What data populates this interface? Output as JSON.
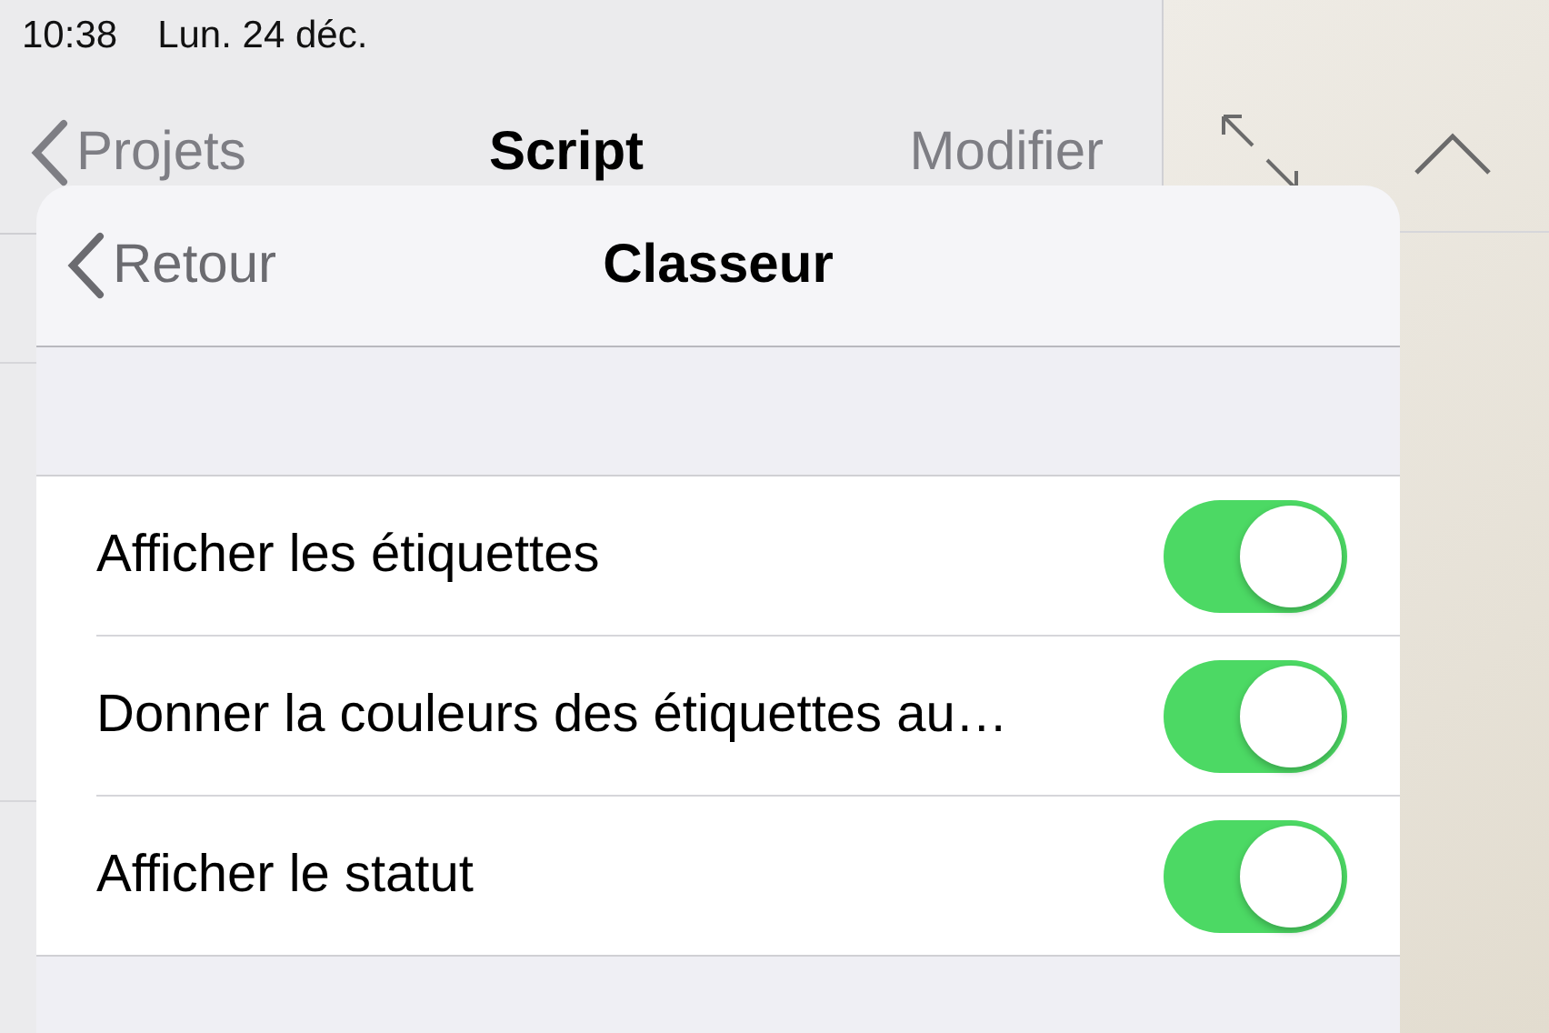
{
  "status_bar": {
    "time": "10:38",
    "date": "Lun. 24 déc."
  },
  "nav_bar": {
    "back": "Projets",
    "title": "Script",
    "action": "Modifier"
  },
  "popover": {
    "back": "Retour",
    "title": "Classeur",
    "settings": [
      {
        "label": "Afficher les étiquettes",
        "on": true
      },
      {
        "label": "Donner la couleurs des étiquettes au…",
        "on": true
      },
      {
        "label": "Afficher le statut",
        "on": true
      }
    ]
  }
}
